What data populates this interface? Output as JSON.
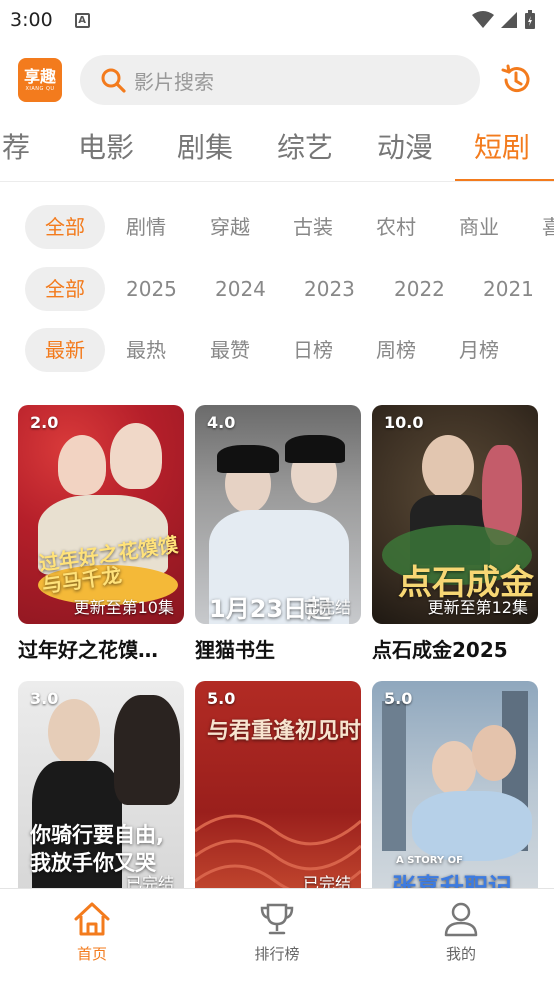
{
  "status_bar": {
    "time": "3:00",
    "notif_letter": "A"
  },
  "header": {
    "logo_main": "享趣",
    "logo_sub": "XIANG QU",
    "search_placeholder": "影片搜索"
  },
  "tabs": [
    {
      "label": "荐",
      "active": false
    },
    {
      "label": "电影",
      "active": false
    },
    {
      "label": "剧集",
      "active": false
    },
    {
      "label": "综艺",
      "active": false
    },
    {
      "label": "动漫",
      "active": false
    },
    {
      "label": "短剧",
      "active": true
    }
  ],
  "filters": {
    "genre": [
      "全部",
      "剧情",
      "穿越",
      "古装",
      "农村",
      "商业",
      "喜"
    ],
    "year": [
      "全部",
      "2025",
      "2024",
      "2023",
      "2022",
      "2021"
    ],
    "sort": [
      "全部",
      "最新",
      "最热",
      "最赞",
      "日榜",
      "周榜",
      "月榜"
    ]
  },
  "sort_row": [
    "最新",
    "最热",
    "最赞",
    "日榜",
    "周榜",
    "月榜"
  ],
  "cards": [
    {
      "rating": "2.0",
      "status": "更新至第10集",
      "title": "过年好之花馍…",
      "poster_text": "过年好之花馍馍与马千龙"
    },
    {
      "rating": "4.0",
      "status": "已完结",
      "title": "狸猫书生",
      "poster_text": "1月23日起"
    },
    {
      "rating": "10.0",
      "status": "更新至第12集",
      "title": "点石成金2025",
      "poster_text": "点石成金"
    },
    {
      "rating": "3.0",
      "status": "已完结",
      "title": "",
      "poster_text_1": "你骑行要自由,",
      "poster_text_2": "我放手你又哭"
    },
    {
      "rating": "5.0",
      "status": "已完结",
      "title": "",
      "poster_text": "与君重逢初见时"
    },
    {
      "rating": "5.0",
      "status": "",
      "title": "",
      "poster_text": "张喜升职记",
      "poster_text_small": "A STORY OF"
    }
  ],
  "bottom_nav": [
    {
      "label": "首页",
      "icon": "home-icon",
      "active": true
    },
    {
      "label": "排行榜",
      "icon": "trophy-icon",
      "active": false
    },
    {
      "label": "我的",
      "icon": "user-icon",
      "active": false
    }
  ],
  "colors": {
    "accent": "#f37b1d",
    "chip_bg": "#eeeeee"
  }
}
